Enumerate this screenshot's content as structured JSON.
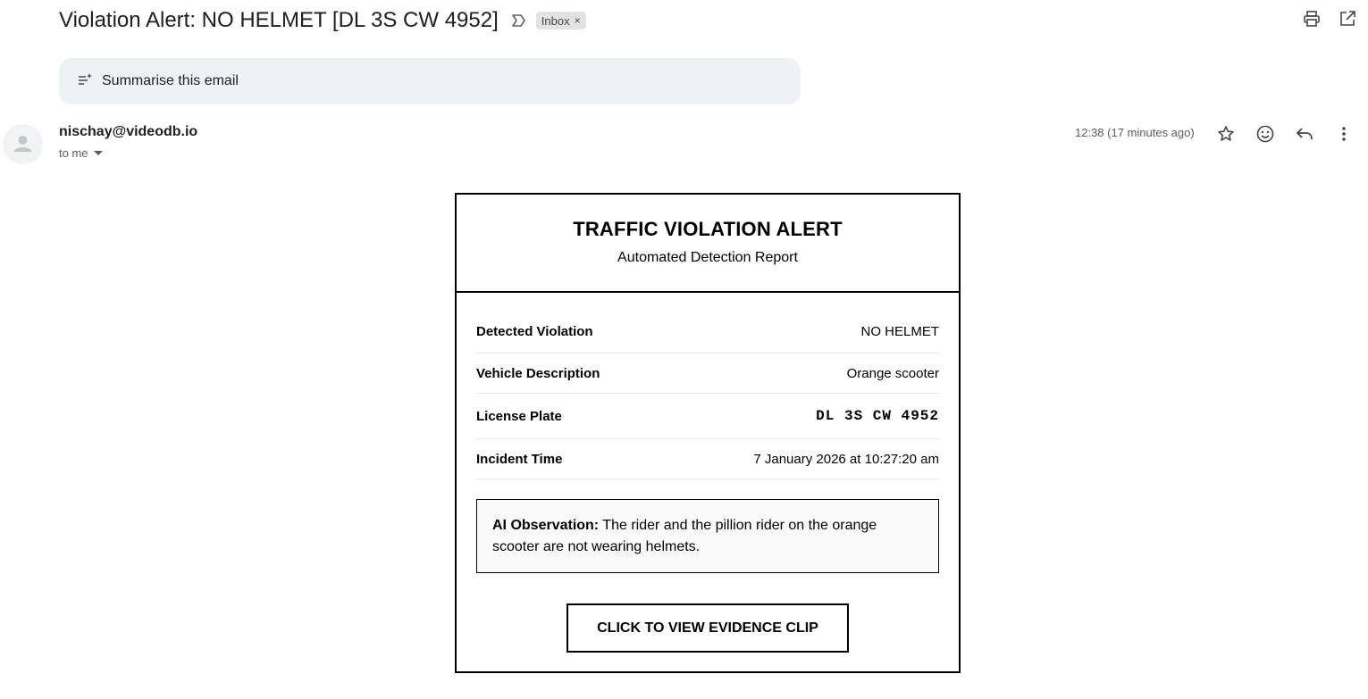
{
  "email": {
    "subject": "Violation Alert: NO HELMET [DL 3S CW 4952]",
    "label_chip": "Inbox",
    "label_chip_close": "×",
    "summarise_label": "Summarise this email",
    "sender": "nischay@videodb.io",
    "recipient": "to me",
    "timestamp": "12:38 (17 minutes ago)"
  },
  "icons": {
    "top_actions": [
      "print-icon",
      "open-in-new-window-icon"
    ],
    "message_actions": [
      "star-icon",
      "emoji-reaction-icon",
      "reply-icon",
      "more-vert-icon"
    ],
    "important_marker": "important-marker-icon",
    "summarise": "summarise-sparkle-icon",
    "avatar": "default-avatar-icon"
  },
  "report": {
    "title": "TRAFFIC VIOLATION ALERT",
    "subtitle": "Automated Detection Report",
    "rows": [
      {
        "label": "Detected Violation",
        "value": "NO HELMET"
      },
      {
        "label": "Vehicle Description",
        "value": "Orange scooter"
      },
      {
        "label": "License Plate",
        "value": "DL 3S CW 4952"
      },
      {
        "label": "Incident Time",
        "value": "7 January 2026 at 10:27:20 am"
      }
    ],
    "observation_label": "AI Observation:",
    "observation_text": "The rider and the pillion rider on the orange scooter are not wearing helmets.",
    "cta_label": "CLICK TO VIEW EVIDENCE CLIP"
  },
  "colors": {
    "summarise_background": "#eef2f7",
    "chip_background": "#e3e3e3",
    "card_border": "#000000"
  }
}
